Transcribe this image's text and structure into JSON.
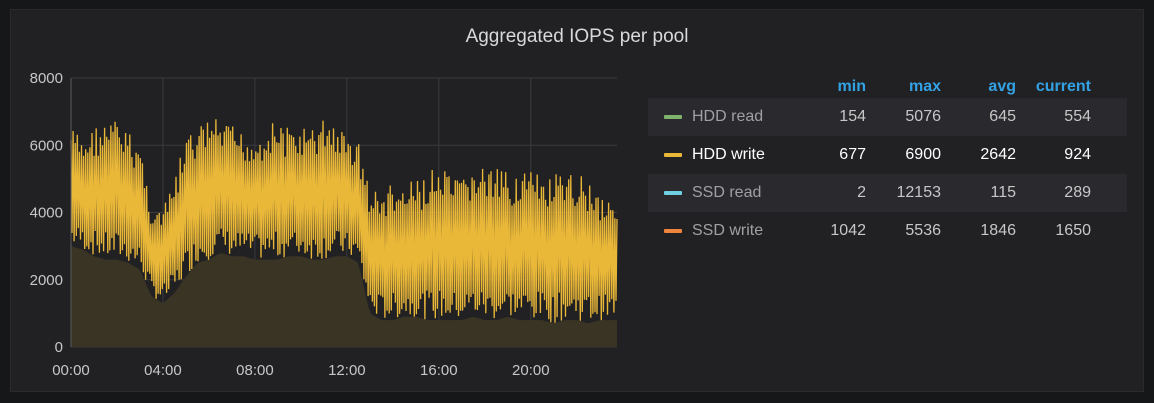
{
  "panel": {
    "title": "Aggregated IOPS per pool"
  },
  "legend": {
    "columns": [
      "min",
      "max",
      "avg",
      "current"
    ],
    "rows": [
      {
        "name": "HDD read",
        "color": "#7eb26d",
        "min": "154",
        "max": "5076",
        "avg": "645",
        "current": "554"
      },
      {
        "name": "HDD write",
        "color": "#eab839",
        "min": "677",
        "max": "6900",
        "avg": "2642",
        "current": "924"
      },
      {
        "name": "SSD read",
        "color": "#6ed0e0",
        "min": "2",
        "max": "12153",
        "avg": "115",
        "current": "289"
      },
      {
        "name": "SSD write",
        "color": "#ef843c",
        "min": "1042",
        "max": "5536",
        "avg": "1846",
        "current": "1650"
      }
    ]
  },
  "chart_data": {
    "type": "area",
    "title": "Aggregated IOPS per pool",
    "xlabel": "",
    "ylabel": "",
    "x_ticks": [
      "00:00",
      "04:00",
      "08:00",
      "12:00",
      "16:00",
      "20:00"
    ],
    "x_tick_hours": [
      0,
      4,
      8,
      12,
      16,
      20
    ],
    "xlim": [
      0,
      23.75
    ],
    "y_ticks": [
      0,
      2000,
      4000,
      6000,
      8000
    ],
    "ylim": [
      0,
      8000
    ],
    "grid": true,
    "series": [
      {
        "name": "HDD write",
        "color": "#eab839",
        "x": [
          0,
          0.5,
          1,
          1.5,
          2,
          2.5,
          3,
          3.5,
          4,
          4.5,
          5,
          5.5,
          6,
          6.5,
          7,
          7.5,
          8,
          8.5,
          9,
          9.5,
          10,
          10.5,
          11,
          11.5,
          12,
          12.5,
          13,
          13.5,
          14,
          14.5,
          15,
          15.5,
          16,
          16.5,
          17,
          17.5,
          18,
          18.5,
          19,
          19.5,
          20,
          20.5,
          21,
          21.5,
          22,
          22.5,
          23,
          23.5
        ],
        "min_values": [
          3000,
          2900,
          2700,
          2600,
          2600,
          2500,
          2300,
          1500,
          1300,
          1600,
          2100,
          2500,
          2600,
          2800,
          2700,
          2700,
          2600,
          2600,
          2600,
          2700,
          2700,
          2600,
          2600,
          2700,
          2700,
          2500,
          1000,
          800,
          800,
          900,
          900,
          800,
          800,
          800,
          800,
          900,
          800,
          800,
          900,
          800,
          800,
          800,
          700,
          800,
          800,
          700,
          800,
          800
        ],
        "max_values": [
          6600,
          6200,
          6600,
          6700,
          6800,
          6400,
          6100,
          4200,
          4100,
          5000,
          6300,
          6500,
          6900,
          6700,
          6600,
          6400,
          6300,
          6600,
          6800,
          6500,
          6600,
          6500,
          6900,
          6700,
          6300,
          6200,
          4700,
          4700,
          4900,
          4800,
          5000,
          5200,
          5400,
          5100,
          5000,
          5500,
          5400,
          5300,
          5200,
          5400,
          5300,
          5000,
          5200,
          5000,
          5300,
          5100,
          4700,
          4600
        ]
      }
    ]
  }
}
